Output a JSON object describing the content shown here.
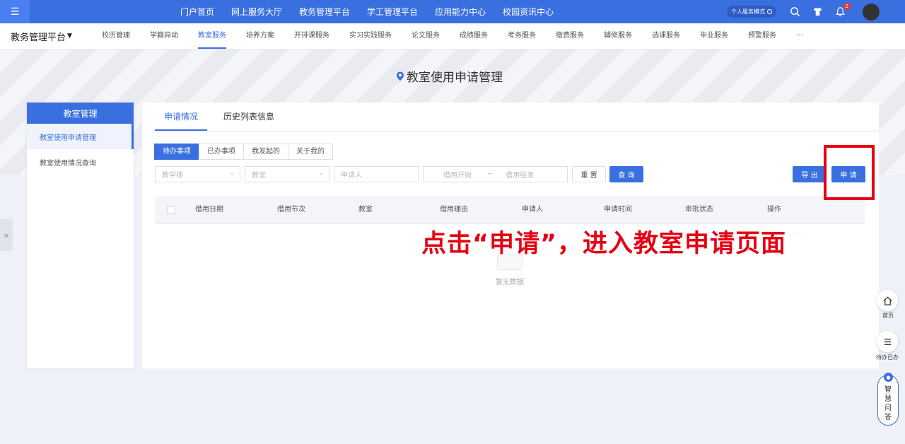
{
  "topbar": {
    "menu_icon": "menu-icon",
    "nav": [
      "门户首页",
      "网上服务大厅",
      "教务管理平台",
      "学工管理平台",
      "应用能力中心",
      "校园资讯中心"
    ],
    "mode_label": "个人服务模式",
    "notification_count": "2"
  },
  "subbar": {
    "platform": "教务管理平台",
    "nav": [
      "校历管理",
      "学籍异动",
      "教室服务",
      "培养方案",
      "开排课服务",
      "实习实践服务",
      "论文服务",
      "成绩服务",
      "考务服务",
      "缴费服务",
      "辅修服务",
      "选课服务",
      "毕业服务",
      "预警服务",
      "···"
    ],
    "active_index": 2
  },
  "page": {
    "title": "教室使用申请管理"
  },
  "sidebar": {
    "header": "教室管理",
    "items": [
      {
        "label": "教室使用申请管理",
        "active": true
      },
      {
        "label": "教室使用情况查询",
        "active": false
      }
    ]
  },
  "tabs": [
    {
      "label": "申请情况",
      "active": true
    },
    {
      "label": "历史列表信息",
      "active": false
    }
  ],
  "filters_segment": [
    "待办事项",
    "已办事项",
    "我发起的",
    "关于我的"
  ],
  "filters": {
    "building_placeholder": "教学楼",
    "classroom_placeholder": "教室",
    "applicant_placeholder": "申请人",
    "start_placeholder": "借用开始",
    "range_sep": "~",
    "end_placeholder": "借用结束",
    "reset": "重 置",
    "query": "查 询",
    "export": "导 出",
    "apply": "申 请"
  },
  "table": {
    "columns": [
      "借用日期",
      "借用节次",
      "教室",
      "借用理由",
      "申请人",
      "申请时间",
      "审批状态",
      "操作"
    ],
    "empty_text": "暂无数据"
  },
  "annotation": {
    "text": "点击“申请”，进入教室申请页面",
    "color": "#e60012"
  },
  "float": {
    "home_label": "首页",
    "todo_label": "待办已办",
    "ai_label": "智慧问答"
  },
  "colors": {
    "primary": "#3a6fe0",
    "annotation": "#e60012"
  }
}
